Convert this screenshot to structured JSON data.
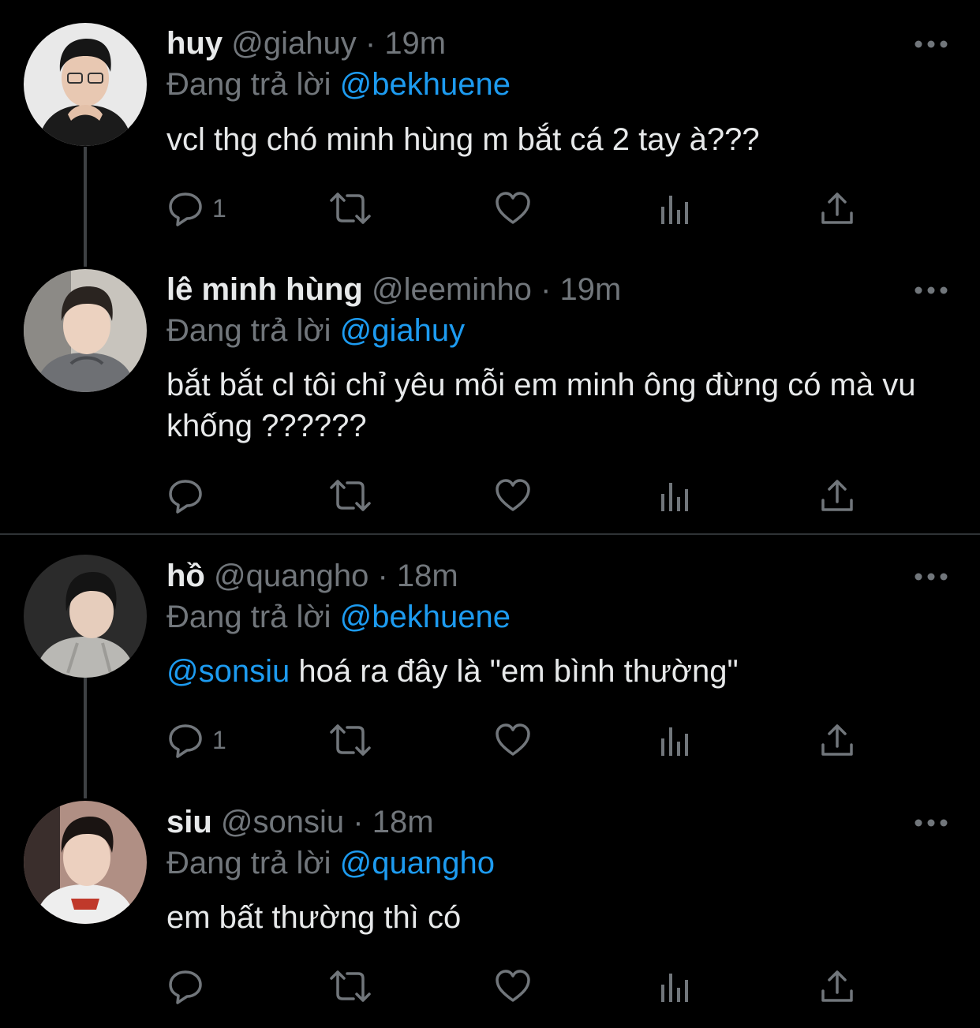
{
  "tweets": [
    {
      "name": "huy",
      "handle": "@giahuy",
      "time": "19m",
      "reply_prefix": "Đang trả lời",
      "reply_to": "@bekhuene",
      "text": "vcl thg chó minh hùng m bắt cá 2 tay à???",
      "reply_count": "1"
    },
    {
      "name": "lê minh hùng",
      "handle": "@leeminho",
      "time": "19m",
      "reply_prefix": "Đang trả lời",
      "reply_to": "@giahuy",
      "text": "bắt bắt cl tôi chỉ yêu mỗi em minh ông đừng có mà vu khống ??????",
      "reply_count": ""
    },
    {
      "name": "hồ",
      "handle": "@quangho",
      "time": "18m",
      "reply_prefix": "Đang trả lời",
      "reply_to": "@bekhuene",
      "mention": "@sonsiu",
      "text": "hoá ra đây là \"em bình thường\"",
      "reply_count": "1"
    },
    {
      "name": "siu",
      "handle": "@sonsiu",
      "time": "18m",
      "reply_prefix": "Đang trả lời",
      "reply_to": "@quangho",
      "text": "em bất thường thì có",
      "reply_count": ""
    }
  ],
  "separator": "·",
  "icons": {
    "reply": "reply-icon",
    "retweet": "retweet-icon",
    "like": "heart-icon",
    "views": "analytics-icon",
    "share": "share-icon",
    "more": "more-icon"
  },
  "colors": {
    "background": "#000000",
    "text": "#e7e9ea",
    "muted": "#71767b",
    "link": "#1d9bf0"
  }
}
